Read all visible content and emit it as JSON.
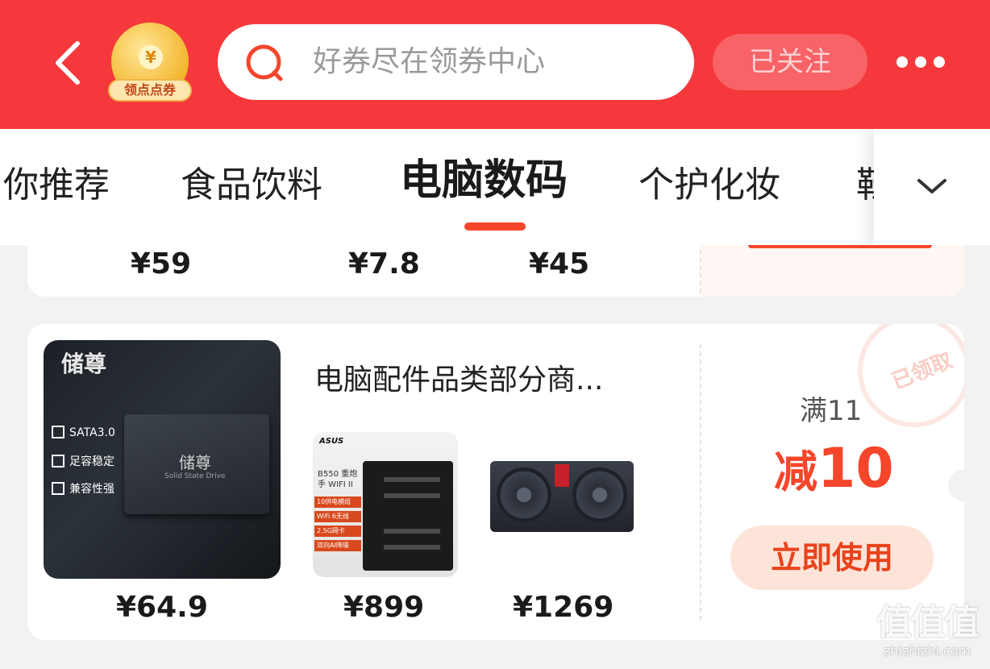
{
  "header": {
    "badge_label": "领点点券",
    "badge_symbol": "¥",
    "search_placeholder": "好券尽在领券中心",
    "follow_label": "已关注",
    "colors": {
      "header_bg": "#f5383b",
      "accent": "#f5452b"
    }
  },
  "tabs": {
    "items": [
      {
        "label": "你推荐"
      },
      {
        "label": "食品饮料"
      },
      {
        "label": "电脑数码",
        "active": true
      },
      {
        "label": "个护化妆"
      },
      {
        "label": "鞋"
      }
    ]
  },
  "card_prev": {
    "prices": [
      "¥59",
      "¥7.8",
      "¥45"
    ]
  },
  "card": {
    "title": "电脑配件品类部分商...",
    "products": [
      {
        "image": "ssd",
        "brand": "储尊",
        "drive_name": "储尊",
        "drive_sub": "Solid State Drive",
        "features": [
          "SATA3.0",
          "足容稳定",
          "兼容性强"
        ],
        "price": "¥64.9"
      },
      {
        "image": "motherboard",
        "brand": "ASUS",
        "model": "B550 重炮手 WIFI II",
        "tags": [
          "10供电模组",
          "WiFi 6无线",
          "2.5G网卡",
          "双向AI降噪"
        ],
        "price": "¥899"
      },
      {
        "image": "graphics-card",
        "price": "¥1269"
      }
    ],
    "coupon": {
      "threshold": "满11",
      "discount_prefix": "减",
      "discount_value": "10",
      "stamp": "已领取",
      "use_label": "立即使用"
    }
  },
  "watermark": {
    "logo": "值值值",
    "url": "zhizhizhi.com"
  }
}
